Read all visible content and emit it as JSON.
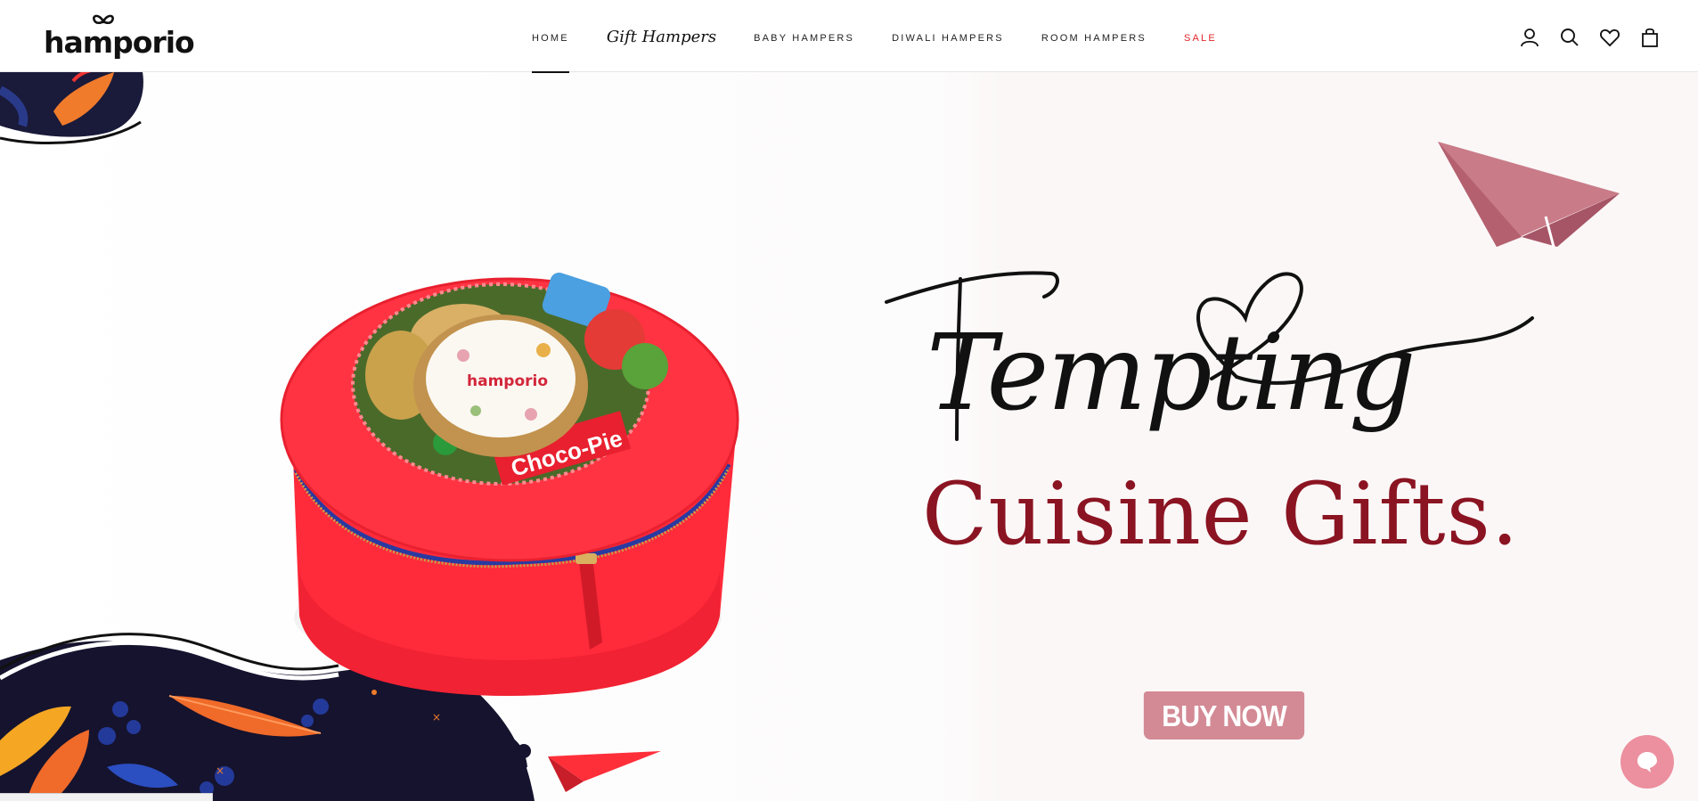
{
  "brand": {
    "name": "hamporio"
  },
  "nav": {
    "items": [
      {
        "label": "HOME"
      },
      {
        "label": "Gift Hampers"
      },
      {
        "label": "BABY HAMPERS"
      },
      {
        "label": "DIWALI HAMPERS"
      },
      {
        "label": "ROOM HAMPERS"
      },
      {
        "label": "SALE"
      }
    ]
  },
  "header_icons": [
    "account-icon",
    "search-icon",
    "wishlist-heart-icon",
    "cart-bag-icon"
  ],
  "hero": {
    "headline_line1": "Tempting",
    "headline_line2": "Cuisine Gifts.",
    "cta_label": "BUY NOW",
    "product_lid_text": "hamporio",
    "product_wrapper_text": "Choco-Pie",
    "colors": {
      "headline_line2": "#8b1422",
      "cta_background": "#d38a95",
      "box_red": "#ff2a3a",
      "paper_plane": "#c97b88"
    }
  },
  "chat": {
    "icon": "chat-bubble-icon"
  }
}
